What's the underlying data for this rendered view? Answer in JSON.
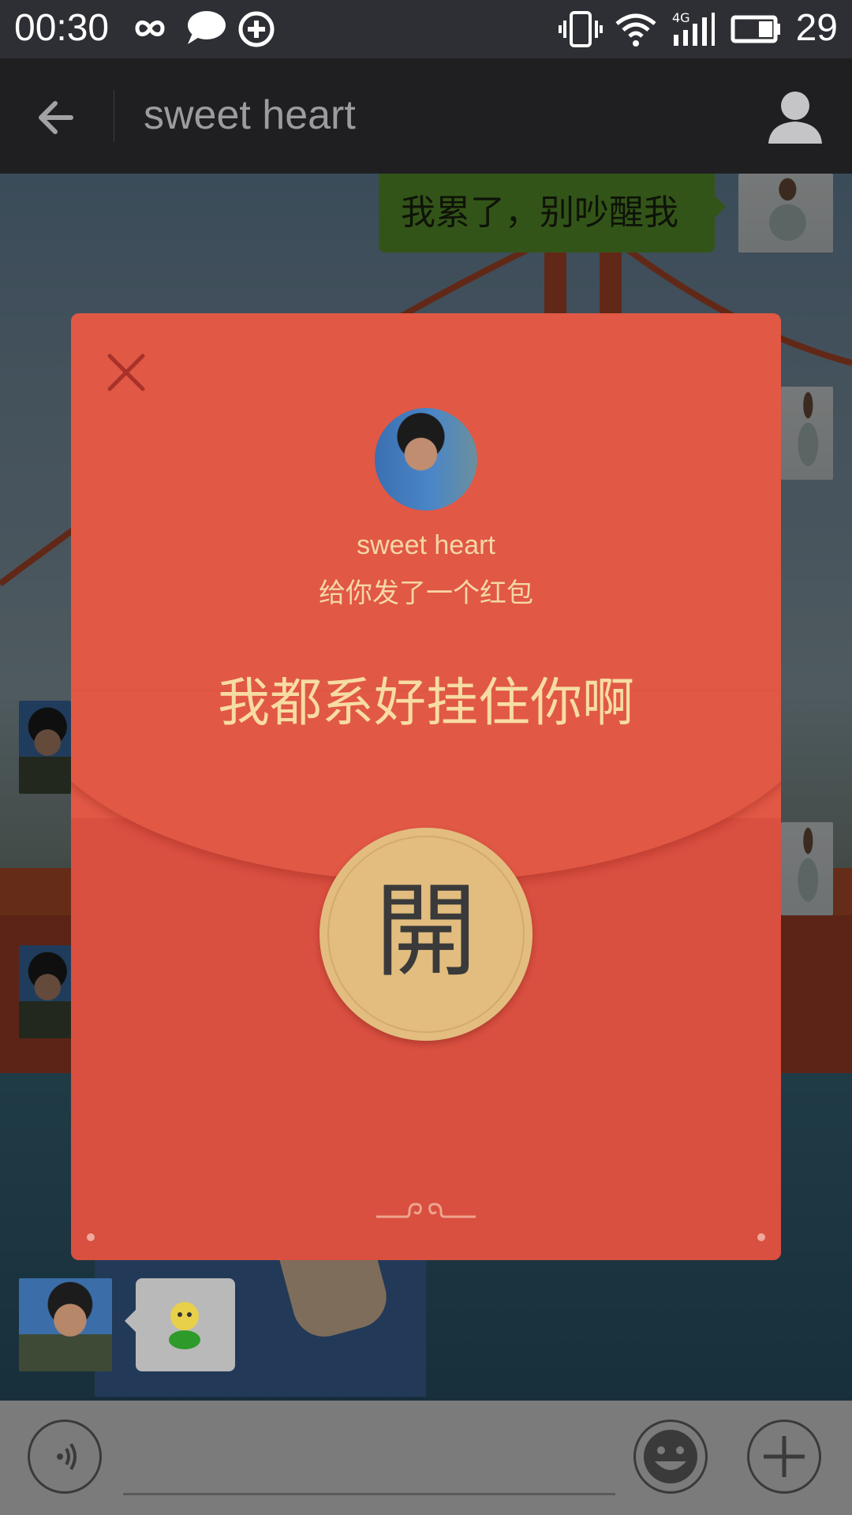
{
  "status_bar": {
    "time": "00:30",
    "battery_level": "29"
  },
  "title_bar": {
    "title": "sweet heart"
  },
  "chat": {
    "outgoing_message": "我累了，别吵醒我"
  },
  "red_packet": {
    "sender_name": "sweet heart",
    "sender_subtitle": "给你发了一个红包",
    "greeting": "我都系好挂住你啊",
    "open_label": "開"
  },
  "colors": {
    "packet_red": "#e15845",
    "open_gold": "#e2bd7f",
    "greeting_gold": "#f7dca3",
    "bubble_green": "#5e9a2c"
  }
}
